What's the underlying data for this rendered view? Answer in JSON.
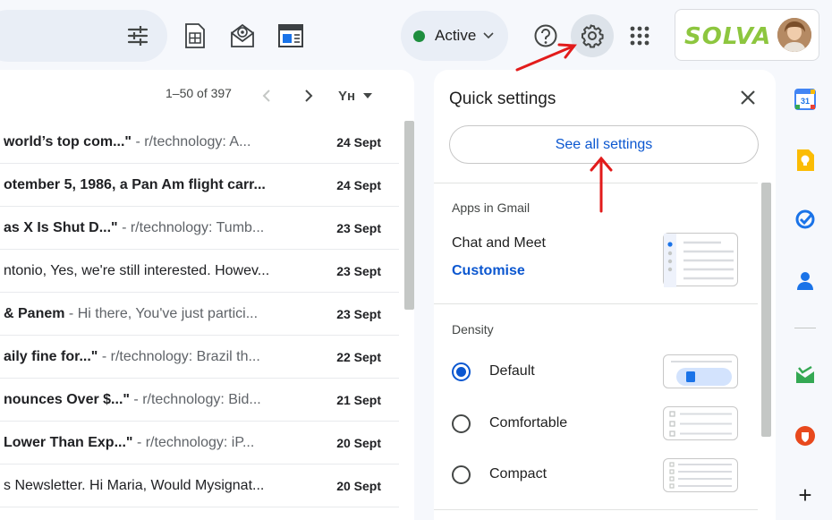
{
  "header": {
    "status_label": "Active",
    "brand_text": "SOLVA"
  },
  "mail": {
    "pager_text": "1–50 of 397",
    "sort_label": "Yʜ",
    "rows": [
      {
        "subject": "world’s top com...\"",
        "snippet": " - r/technology: A...",
        "date": "24 Sept",
        "unread": true
      },
      {
        "subject": "otember 5, 1986, a Pan Am flight carr...",
        "snippet": "",
        "date": "24 Sept",
        "unread": true
      },
      {
        "subject": "as X Is Shut D...\"",
        "snippet": " - r/technology: Tumb...",
        "date": "23 Sept",
        "unread": true
      },
      {
        "subject": "ntonio, Yes, we're still interested. Howev...",
        "snippet": "",
        "date": "23 Sept",
        "unread": false
      },
      {
        "subject": "& Panem",
        "snippet": " - Hi there, You've just partici...",
        "date": "23 Sept",
        "unread": true
      },
      {
        "subject": "aily fine for...\"",
        "snippet": " - r/technology: Brazil th...",
        "date": "22 Sept",
        "unread": true
      },
      {
        "subject": "nounces Over $...\"",
        "snippet": " - r/technology: Bid...",
        "date": "21 Sept",
        "unread": true
      },
      {
        "subject": " Lower Than Exp...\"",
        "snippet": " - r/technology: iP...",
        "date": "20 Sept",
        "unread": true
      },
      {
        "subject": "s Newsletter. Hi Maria, Would Mysignat...",
        "snippet": "",
        "date": "20 Sept",
        "unread": false
      }
    ]
  },
  "quick_settings": {
    "title": "Quick settings",
    "see_all_label": "See all settings",
    "apps_section_title": "Apps in Gmail",
    "apps_label": "Chat and Meet",
    "customise_label": "Customise",
    "density_title": "Density",
    "density_options": [
      {
        "label": "Default",
        "checked": true
      },
      {
        "label": "Comfortable",
        "checked": false
      },
      {
        "label": "Compact",
        "checked": false
      }
    ]
  },
  "side_rail": {
    "calendar_day": "31",
    "add_label": "+"
  },
  "colors": {
    "accent_blue": "#0b57d0",
    "active_green": "#1e8e3e",
    "brand_green": "#8dc63f",
    "annotation_red": "#e21b1b"
  },
  "icons": [
    "filter-icon",
    "sheets-icon",
    "mail-merge-icon",
    "layout-icon",
    "help-icon",
    "gear-icon",
    "apps-grid-icon",
    "chevron-left-icon",
    "chevron-right-icon",
    "close-icon",
    "calendar-icon",
    "keep-icon",
    "tasks-icon",
    "contacts-icon",
    "add-on-icon",
    "add-icon"
  ]
}
